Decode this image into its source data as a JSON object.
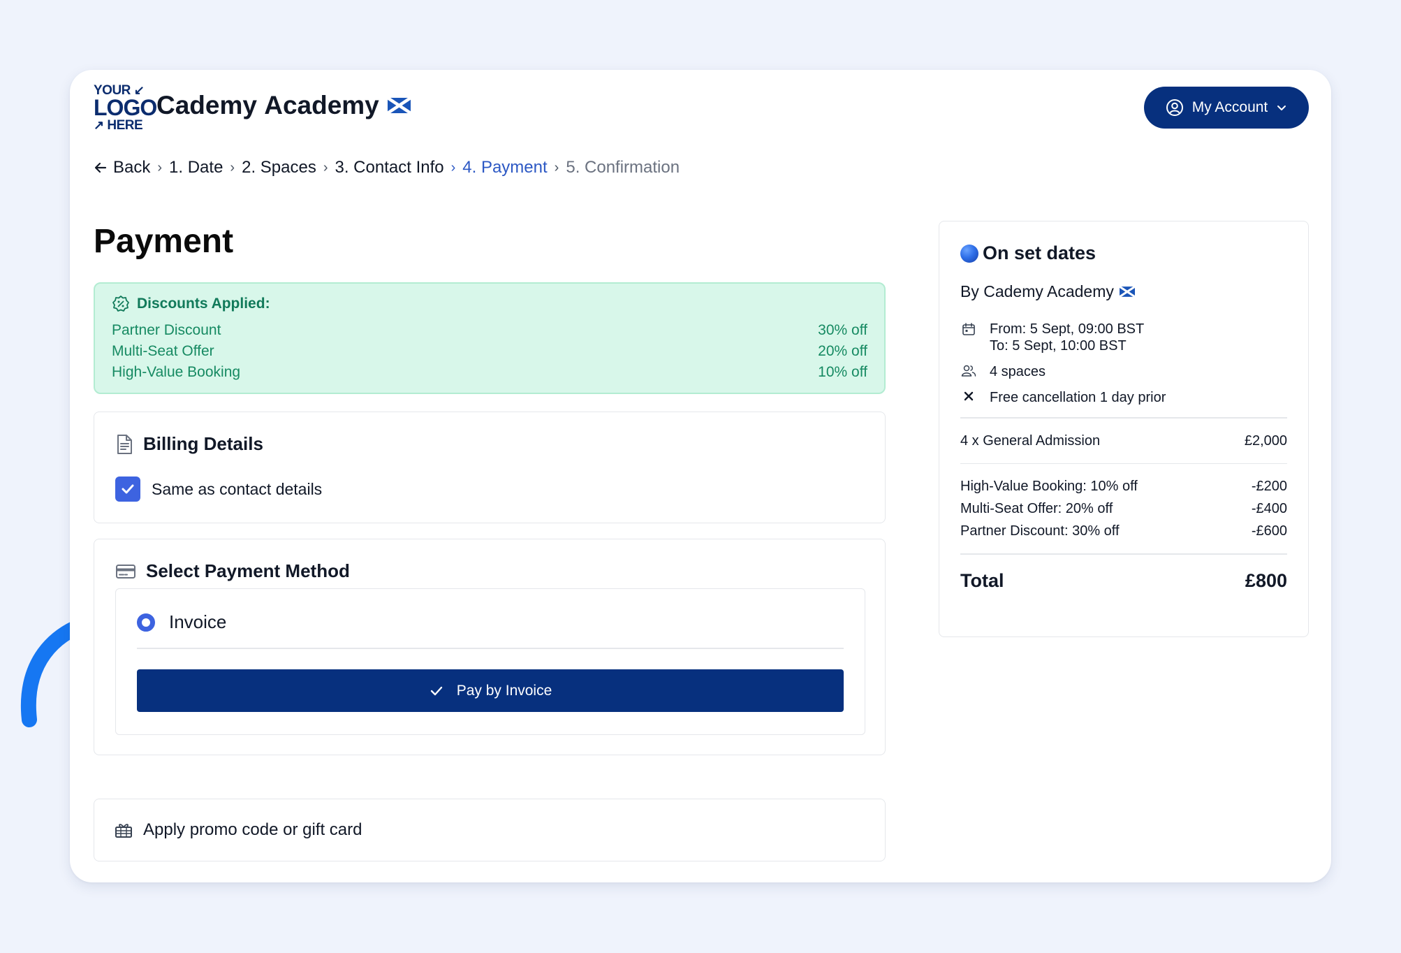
{
  "header": {
    "logo": {
      "line1": "YOUR",
      "line2": "LOGO",
      "line3": "HERE"
    },
    "academy_name": "Cademу Academy",
    "account_label": "My Account"
  },
  "breadcrumb": {
    "back": "Back",
    "steps": [
      "1. Date",
      "2. Spaces",
      "3. Contact Info",
      "4. Payment",
      "5. Confirmation"
    ],
    "active_index": 3
  },
  "page": {
    "title": "Payment"
  },
  "discounts": {
    "heading": "Discounts Applied:",
    "items": [
      {
        "label": "Partner Discount",
        "value": "30% off"
      },
      {
        "label": "Multi-Seat Offer",
        "value": "20% off"
      },
      {
        "label": "High-Value Booking",
        "value": "10% off"
      }
    ]
  },
  "billing": {
    "heading": "Billing Details",
    "same_as_contact": "Same as contact details",
    "checked": true
  },
  "payment": {
    "heading": "Select Payment Method",
    "method": "Invoice",
    "pay_button": "Pay by Invoice"
  },
  "promo": {
    "label": "Apply promo code or gift card"
  },
  "summary": {
    "title": "On set dates",
    "by": "By Cademy Academy",
    "from": "From: 5 Sept, 09:00 BST",
    "to": "To: 5 Sept, 10:00 BST",
    "spaces": "4 spaces",
    "cancellation": "Free cancellation 1 day prior",
    "admission_label": "4 x General Admission",
    "admission_value": "£2,000",
    "discount_lines": [
      {
        "label": "High-Value Booking: 10% off",
        "value": "-£200"
      },
      {
        "label": "Multi-Seat Offer: 20% off",
        "value": "-£400"
      },
      {
        "label": "Partner Discount: 30% off",
        "value": "-£600"
      }
    ],
    "total_label": "Total",
    "total_value": "£800"
  },
  "colors": {
    "brand_navy": "#07307e",
    "accent_blue": "#3d63e0",
    "discount_bg": "#d8f7ea",
    "discount_text": "#117a5a",
    "annotation_arrow": "#1677f2"
  }
}
